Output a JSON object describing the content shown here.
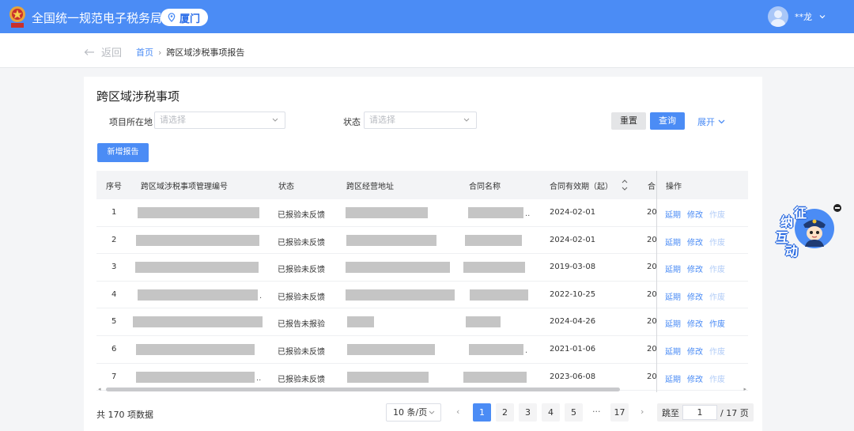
{
  "header": {
    "brand": "全国统一规范电子税务局",
    "city": "厦门",
    "user": "**龙"
  },
  "subnav": {
    "back": "返回",
    "home": "首页",
    "sep": "›",
    "current": "跨区域涉税事项报告"
  },
  "page": {
    "title": "跨区域涉税事项",
    "filters": {
      "location_label": "项目所在地",
      "location_placeholder": "请选择",
      "status_label": "状态",
      "status_placeholder": "请选择"
    },
    "reset": "重置",
    "query": "查询",
    "expand": "展开",
    "add": "新增报告"
  },
  "table": {
    "headers": [
      "序号",
      "跨区域涉税事项管理编号",
      "状态",
      "跨区经营地址",
      "合同名称",
      "合同有效期（起）",
      "合",
      "操作"
    ],
    "rows": [
      {
        "no": "1",
        "status": "已报验未反馈",
        "date": "2024-02-01",
        "next": "20",
        "contract_tail": "..",
        "mgmt_tail": ""
      },
      {
        "no": "2",
        "status": "已报验未反馈",
        "date": "2024-02-01",
        "next": "20",
        "contract_tail": "",
        "mgmt_tail": ""
      },
      {
        "no": "3",
        "status": "已报验未反馈",
        "date": "2019-03-08",
        "next": "20",
        "contract_tail": "",
        "mgmt_tail": ""
      },
      {
        "no": "4",
        "status": "已报验未反馈",
        "date": "2022-10-25",
        "next": "20",
        "contract_tail": "",
        "mgmt_tail": "."
      },
      {
        "no": "5",
        "status": "已报告未报验",
        "date": "2024-04-26",
        "next": "20",
        "contract_tail": "",
        "mgmt_tail": ""
      },
      {
        "no": "6",
        "status": "已报验未反馈",
        "date": "2021-01-06",
        "next": "20",
        "contract_tail": ".",
        "mgmt_tail": ""
      },
      {
        "no": "7",
        "status": "已报验未反馈",
        "date": "2023-06-08",
        "next": "20",
        "contract_tail": "",
        "mgmt_tail": ".."
      }
    ],
    "ops": {
      "extend": "延期",
      "modify": "修改",
      "void": "作废"
    },
    "void_enabled_rows": [
      5
    ]
  },
  "pagination": {
    "total": "共 170 项数据",
    "page_size": "10 条/页",
    "pages": [
      "1",
      "2",
      "3",
      "4",
      "5"
    ],
    "ellipsis": "···",
    "last": "17",
    "prev": "‹",
    "next": "›",
    "jump_label": "跳至",
    "jump_value": "1",
    "jump_suffix": "/ 17 页"
  },
  "widget": {
    "chars": [
      "征",
      "纳",
      "互",
      "动"
    ]
  },
  "colors": {
    "primary": "#4b8cf5",
    "disabled_link": "#b3cdf7"
  }
}
